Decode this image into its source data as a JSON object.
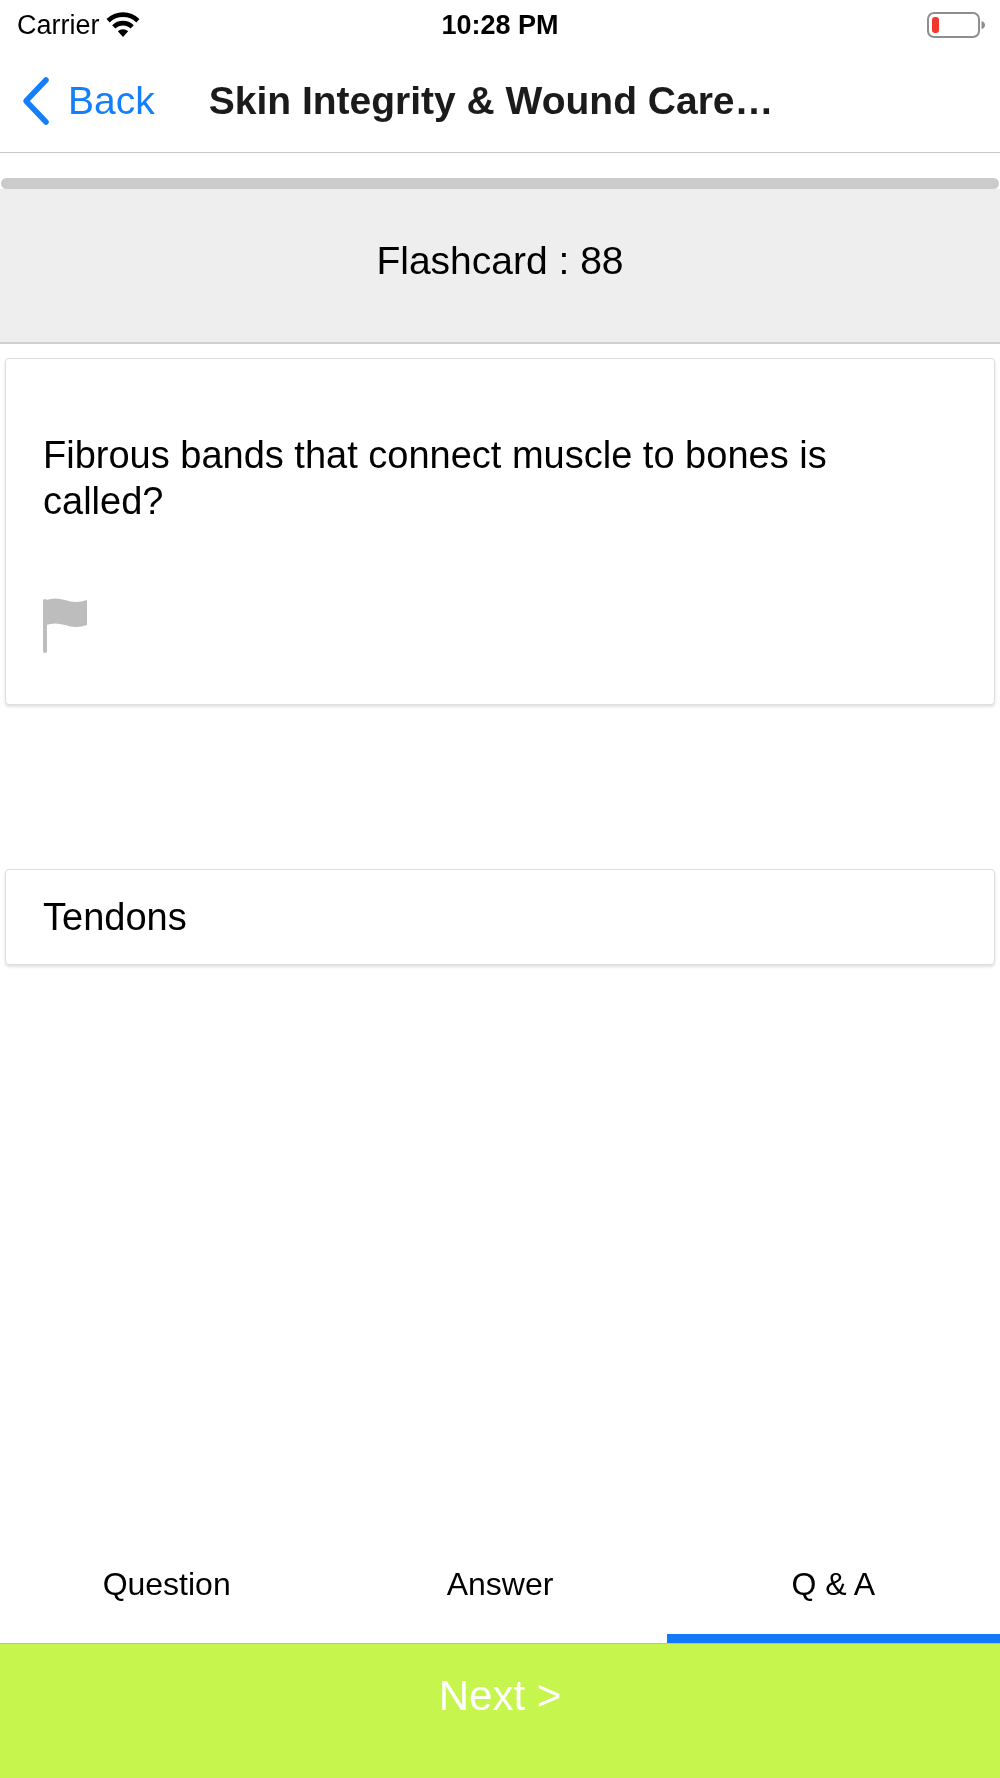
{
  "status_bar": {
    "carrier": "Carrier",
    "time": "10:28 PM"
  },
  "nav_bar": {
    "back": "Back",
    "title": "Skin Integrity & Wound Care…"
  },
  "progress": {
    "level": 1
  },
  "header": {
    "title": "Flashcard : 88"
  },
  "question_card": {
    "text": "Fibrous bands that connect muscle to bones is called?",
    "flagged": false
  },
  "answer_card": {
    "text": "Tendons"
  },
  "tabs": [
    {
      "label": "Question",
      "selected": false
    },
    {
      "label": "Answer",
      "selected": false
    },
    {
      "label": "Q & A",
      "selected": true
    }
  ],
  "next_button": {
    "label": "Next >"
  }
}
